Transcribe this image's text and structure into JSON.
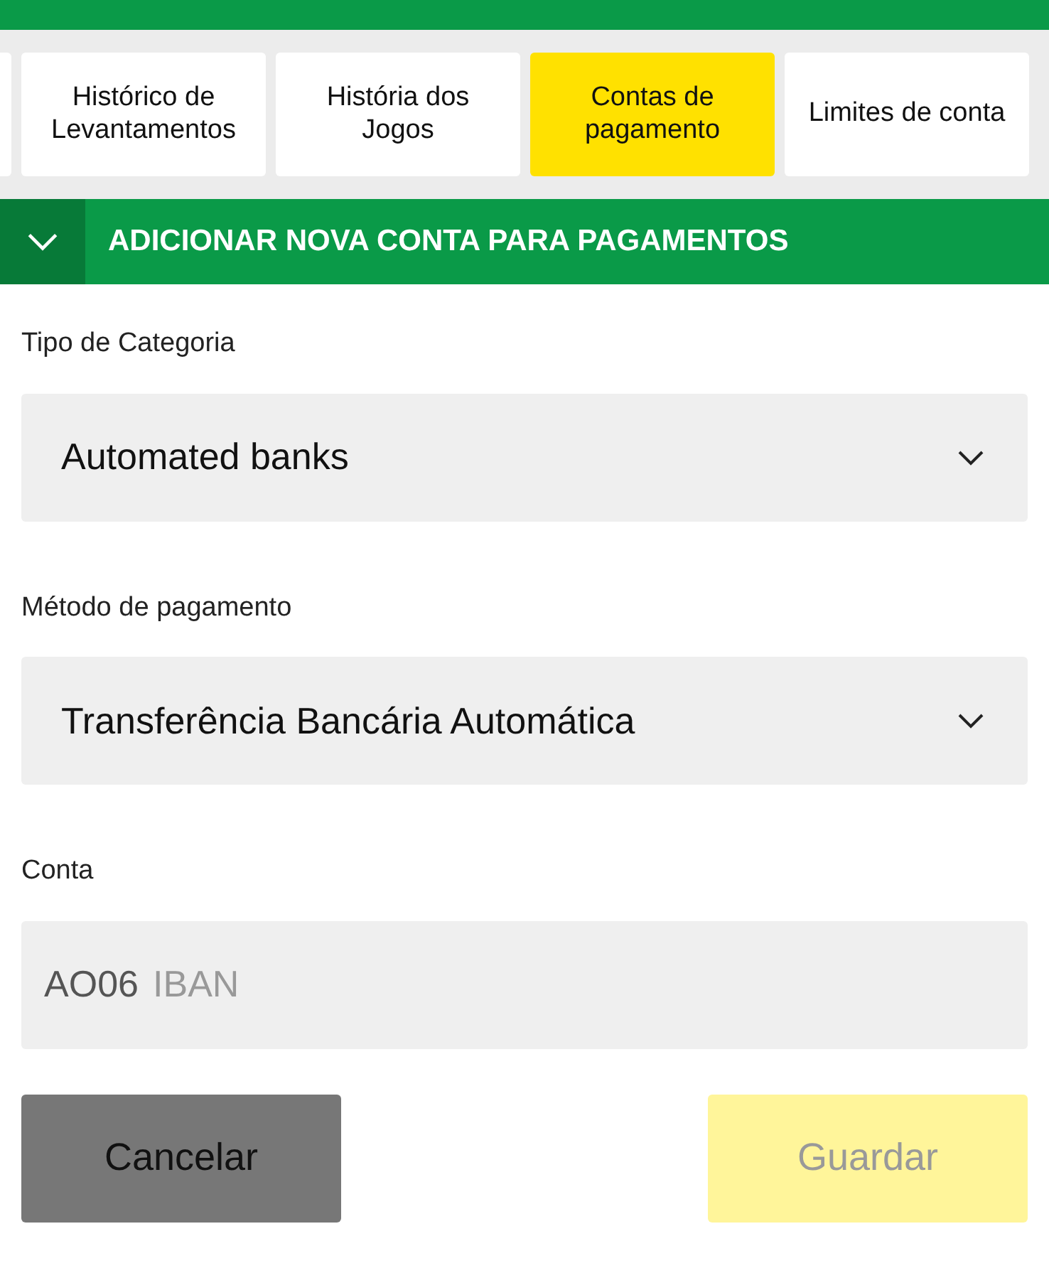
{
  "tabs": [
    {
      "label": "Histórico de Levantamentos",
      "selected": false
    },
    {
      "label": "História dos Jogos",
      "selected": false
    },
    {
      "label": "Contas de pagamento",
      "selected": true
    },
    {
      "label": "Limites de conta",
      "selected": false
    }
  ],
  "section": {
    "title": "ADICIONAR NOVA CONTA PARA PAGAMENTOS",
    "expanded": true
  },
  "fields": [
    {
      "kind": "select",
      "label": "Tipo de Categoria",
      "value": "Automated banks"
    },
    {
      "kind": "select",
      "label": "Método de pagamento",
      "value": "Transferência Bancária Automática"
    },
    {
      "kind": "input",
      "label": "Conta",
      "prefix": "AO06",
      "placeholder": "IBAN"
    }
  ],
  "buttons": [
    {
      "label": "Cancelar",
      "kind": "cancel"
    },
    {
      "label": "Guardar",
      "kind": "save",
      "disabled": true
    }
  ]
}
